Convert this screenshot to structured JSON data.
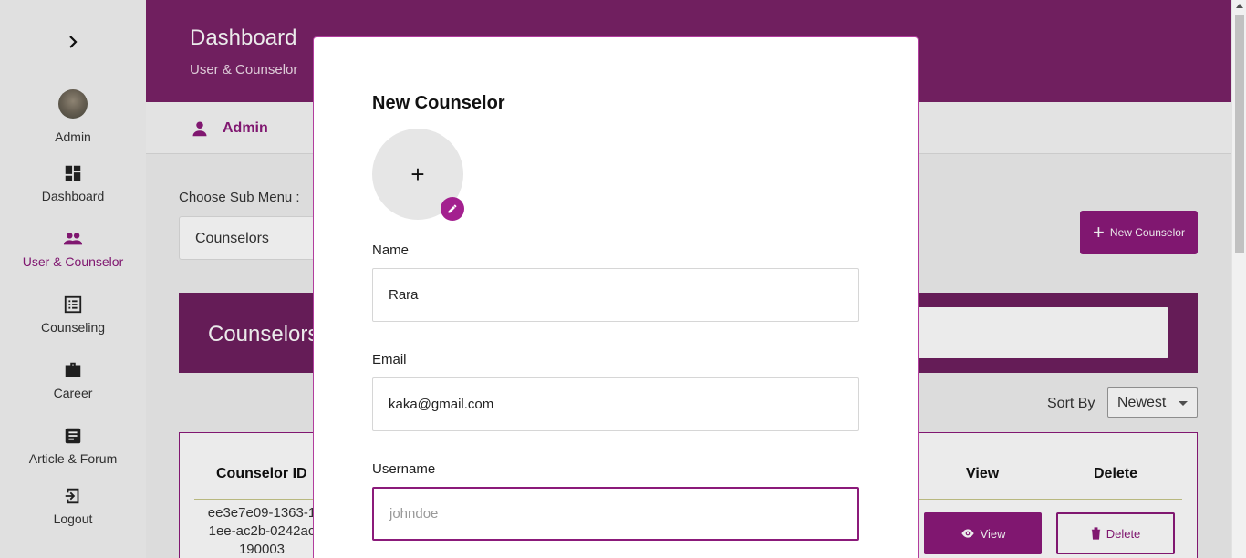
{
  "sidebar": {
    "toggle_glyph": "›",
    "items": [
      {
        "label": "Admin",
        "icon": "avatar"
      },
      {
        "label": "Dashboard",
        "icon": "dashboard-icon"
      },
      {
        "label": "User & Counselor",
        "icon": "people-icon"
      },
      {
        "label": "Counseling",
        "icon": "list-icon"
      },
      {
        "label": "Career",
        "icon": "briefcase-icon"
      },
      {
        "label": "Article & Forum",
        "icon": "article-icon"
      },
      {
        "label": "Logout",
        "icon": "logout-icon"
      }
    ],
    "active_color": "#8b1a7a"
  },
  "header": {
    "title": "Dashboard",
    "subtitle": "User & Counselor"
  },
  "adminbar": {
    "label": "Admin"
  },
  "submenu": {
    "label": "Choose Sub Menu :",
    "value": "Counselors"
  },
  "new_button": {
    "label": "New Counselor"
  },
  "banner": {
    "title": "Counselors"
  },
  "sort": {
    "label": "Sort By",
    "value": "Newest"
  },
  "table": {
    "headers": {
      "id": "Counselor ID",
      "view": "View",
      "delete": "Delete"
    },
    "rows": [
      {
        "id": "ee3e7e09-1363-11ee-ac2b-0242ac190003",
        "view": "View",
        "delete": "Delete"
      }
    ]
  },
  "modal": {
    "title": "New Counselor",
    "photo_glyph": "+",
    "fields": {
      "name": {
        "label": "Name",
        "value": "Rara"
      },
      "email": {
        "label": "Email",
        "value": "kaka@gmail.com"
      },
      "username": {
        "label": "Username",
        "value": "",
        "placeholder": "johndoe"
      }
    }
  },
  "colors": {
    "brand": "#7a2268",
    "accent": "#8b1a7a"
  }
}
